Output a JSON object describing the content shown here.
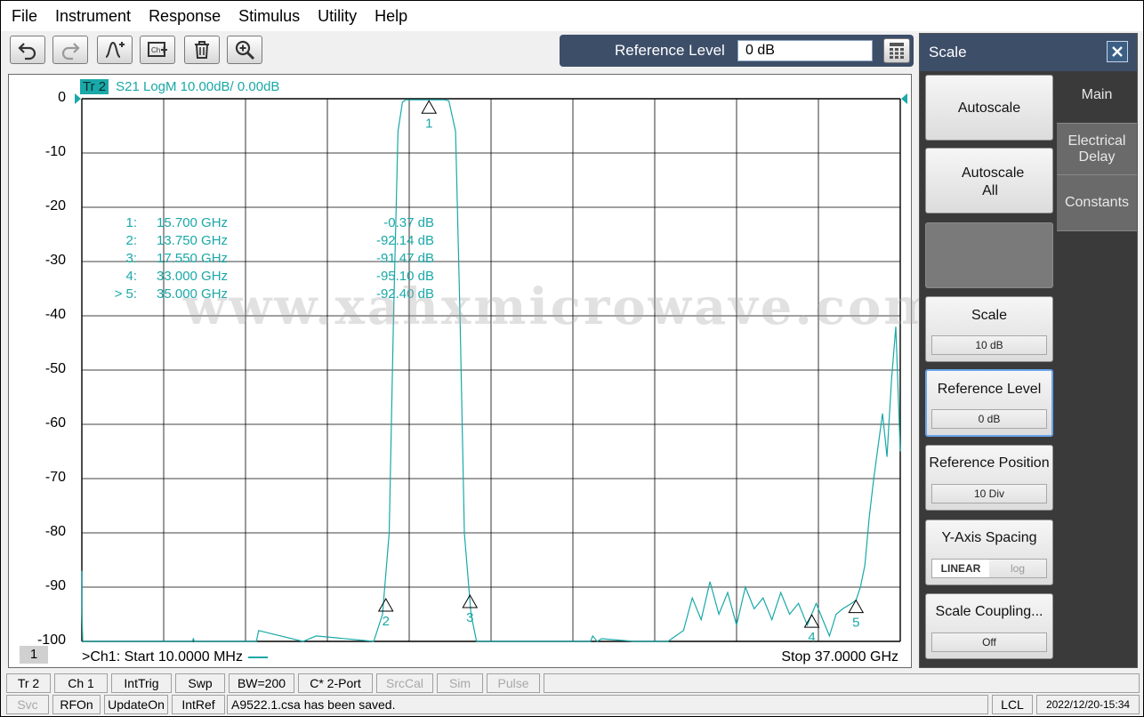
{
  "menu": [
    "File",
    "Instrument",
    "Response",
    "Stimulus",
    "Utility",
    "Help"
  ],
  "toolbar": {
    "buttons": [
      "undo-icon",
      "redo-icon",
      "add-marker-icon",
      "add-channel-icon",
      "delete-icon",
      "zoom-icon"
    ],
    "entry_label": "Reference Level",
    "entry_value": "0 dB"
  },
  "trace": {
    "tag": "Tr 2",
    "description": "S21 LogM 10.00dB/  0.00dB",
    "color": "#1aa8a8"
  },
  "chart_data": {
    "type": "line",
    "title": "S21 LogM 10.00dB/  0.00dB",
    "xlabel": "",
    "ylabel": "",
    "xlim": [
      0.01,
      37.0
    ],
    "ylim": [
      -100,
      0
    ],
    "yticks": [
      0,
      -10,
      -20,
      -30,
      -40,
      -50,
      -60,
      -70,
      -80,
      -90,
      -100
    ],
    "grid": true,
    "series": [
      {
        "name": "Tr 2",
        "x": [
          0.01,
          0.01,
          0.05,
          2.7,
          2.75,
          2.8,
          5.0,
          5.05,
          5.1,
          7.9,
          8.0,
          10.0,
          10.6,
          13.2,
          13.6,
          13.9,
          14.1,
          14.3,
          14.5,
          14.65,
          14.8,
          16.4,
          16.6,
          16.9,
          17.1,
          17.3,
          17.6,
          17.85,
          23.0,
          23.1,
          23.3,
          23.5,
          25.0,
          26.5,
          27.2,
          27.6,
          28.0,
          28.4,
          28.8,
          29.2,
          29.6,
          30.0,
          30.4,
          30.8,
          31.2,
          31.6,
          32.0,
          32.4,
          32.8,
          33.0,
          33.2,
          33.5,
          33.8,
          34.1,
          34.4,
          34.8,
          35.0,
          35.2,
          35.4,
          35.6,
          35.8,
          36.0,
          36.2,
          36.4,
          36.6,
          36.8,
          37.0
        ],
        "y": [
          -87,
          -94,
          -101,
          -101,
          -100,
          -101,
          -101,
          -99.5,
          -101,
          -101,
          -98,
          -101,
          -99,
          -101,
          -95,
          -80,
          -40,
          -6,
          -0.6,
          -0.2,
          -0.2,
          -0.2,
          -0.4,
          -6,
          -40,
          -80,
          -95,
          -101,
          -101,
          -99,
          -101,
          -99.5,
          -101,
          -101,
          -98,
          -92,
          -96,
          -89,
          -95,
          -91,
          -97,
          -90,
          -94,
          -92,
          -96,
          -91,
          -95,
          -93,
          -97,
          -95,
          -93,
          -96,
          -99,
          -95,
          -94,
          -93,
          -92.4,
          -90,
          -86,
          -77,
          -70,
          -64,
          -58,
          -66,
          -52,
          -42,
          -65
        ]
      }
    ],
    "markers": [
      {
        "id": "1:",
        "label": "1",
        "freq": "15.700  GHz",
        "value": "-0.37 dB",
        "x": 15.7,
        "y": -0.37
      },
      {
        "id": "2:",
        "label": "2",
        "freq": "13.750  GHz",
        "value": "-92.14 dB",
        "x": 13.75,
        "y": -92.14
      },
      {
        "id": "3:",
        "label": "3",
        "freq": "17.550  GHz",
        "value": "-91.47 dB",
        "x": 17.55,
        "y": -91.47
      },
      {
        "id": "4:",
        "label": "4",
        "freq": "33.000  GHz",
        "value": "-95.10 dB",
        "x": 33.0,
        "y": -95.1
      },
      {
        "id": "> 5:",
        "label": "5",
        "freq": "35.000  GHz",
        "value": "-92.40 dB",
        "x": 35.0,
        "y": -92.4
      }
    ]
  },
  "watermark": "www.xahxmicrowave.com",
  "axis": {
    "channel_badge": "1",
    "start_text": ">Ch1:  Start   10.0000 MHz",
    "stop_text": "Stop  37.0000 GHz"
  },
  "scale_panel": {
    "title": "Scale",
    "tabs": [
      "Main",
      "Electrical Delay",
      "Constants"
    ],
    "autoscale": "Autoscale",
    "autoscale_all": "Autoscale All",
    "scale_label": "Scale",
    "scale_value": "10 dB",
    "reflevel_label": "Reference Level",
    "reflevel_value": "0 dB",
    "refpos_label": "Reference Position",
    "refpos_value": "10 Div",
    "yspacing_label": "Y-Axis Spacing",
    "yspacing_linear": "LINEAR",
    "yspacing_log": "log",
    "coupling_label": "Scale Coupling...",
    "coupling_value": "Off"
  },
  "status1": [
    "Tr 2",
    "Ch 1",
    "IntTrig",
    "Swp",
    "BW=200",
    "C* 2-Port",
    "SrcCal",
    "Sim",
    "Pulse"
  ],
  "status2": {
    "items": [
      "Svc",
      "RFOn",
      "UpdateOn",
      "IntRef"
    ],
    "message": "A9522.1.csa has been saved.",
    "lcl": "LCL",
    "datetime": "2022/12/20-15:34"
  },
  "colors": {
    "trace": "#1aa8a8",
    "panel_header": "#3d4e69",
    "selected_border": "#6aa4ea"
  }
}
